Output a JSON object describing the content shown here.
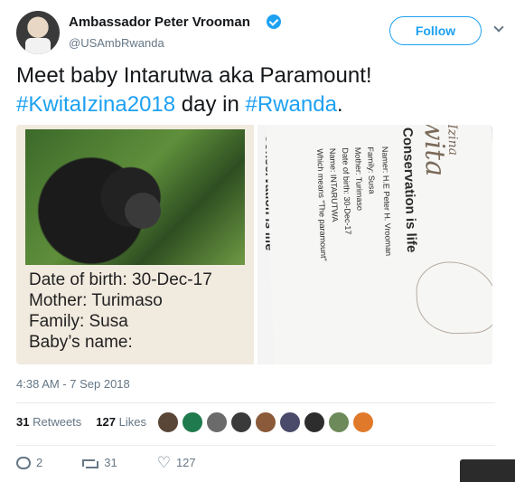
{
  "author": {
    "name": "Ambassador Peter Vrooman",
    "handle": "@USAmbRwanda"
  },
  "follow_label": "Follow",
  "tweet": {
    "text_line1": "Meet baby Intarutwa aka Paramount!",
    "hashtag1": "#KwitaIzina2018",
    "text_mid": " day in ",
    "hashtag2": "#Rwanda",
    "text_end": "."
  },
  "media": {
    "card_lines": [
      "Date of birth: 30-Dec-17",
      "Mother: Turimaso",
      "Family: Susa",
      "Baby’s name:"
    ],
    "right_photo": {
      "brand_top": "wita",
      "brand_sub": "Izina",
      "conservation": "Conservation is life",
      "namer": "Namer: H.E Peter H. Vrooman",
      "family": "Family: Susa",
      "mother": "Mother: Turimaso",
      "dob": "Date of birth: 30-Dec-17",
      "name": "Name: INTARUTWA",
      "means": "Which means \"The paramount\"",
      "conservation_left": "Conservation is life"
    }
  },
  "timestamp": "4:38 AM - 7 Sep 2018",
  "stats": {
    "retweets_count": "31",
    "retweets_label": "Retweets",
    "likes_count": "127",
    "likes_label": "Likes"
  },
  "likers_colors": [
    "#5a4636",
    "#1f7a4d",
    "#6b6b6b",
    "#3a3a3a",
    "#8a5a3a",
    "#4a4a6a",
    "#2d2d2d",
    "#6d8b5a",
    "#e07a2a"
  ],
  "actions": {
    "reply_count": "2",
    "retweet_count": "31",
    "like_count": "127"
  },
  "colors": {
    "accent": "#1da1f2",
    "muted": "#657786",
    "text": "#14171a"
  }
}
